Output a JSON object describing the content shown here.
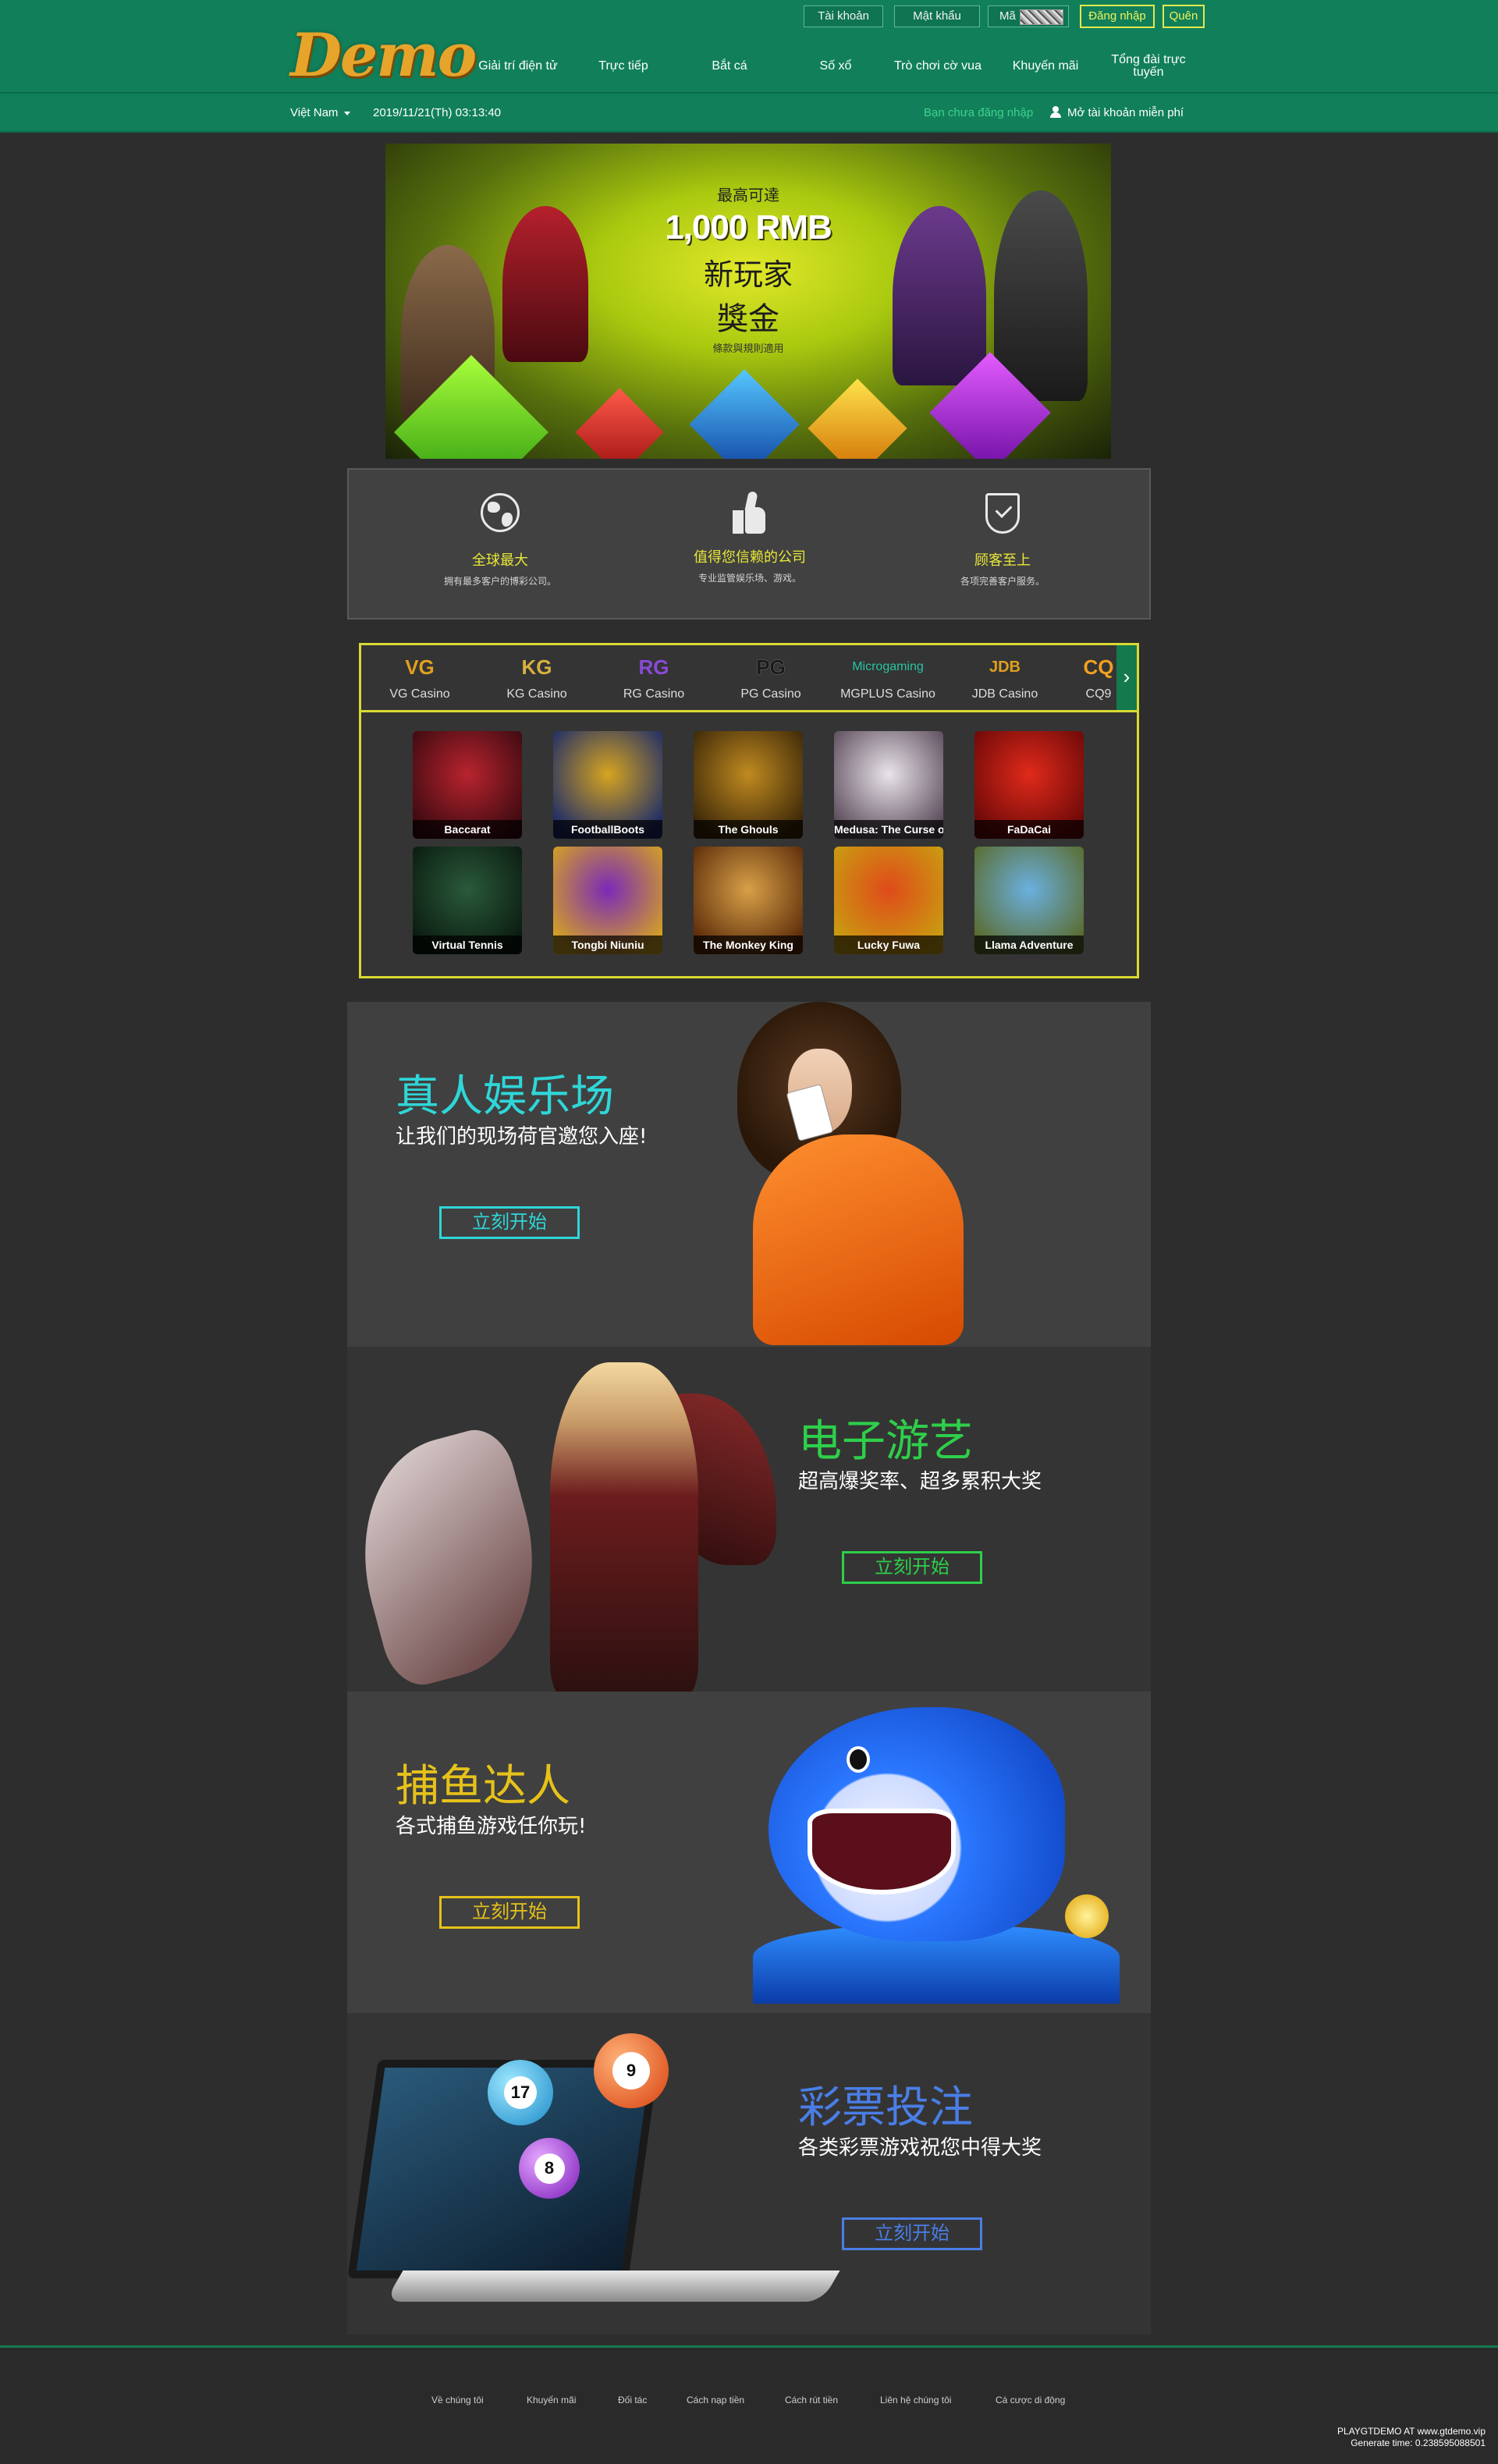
{
  "header": {
    "logo_text": "Demo",
    "auth": {
      "account_placeholder": "Tài khoản",
      "password_placeholder": "Mật khẩu",
      "captcha_label": "Mã",
      "login_label": "Đăng nhập",
      "forgot_label": "Quên"
    },
    "nav": [
      {
        "label": "Giải trí điện tử"
      },
      {
        "label": "Trực tiếp"
      },
      {
        "label": "Bắt cá"
      },
      {
        "label": "Số xổ"
      },
      {
        "label": "Trò chơi cờ vua"
      },
      {
        "label": "Khuyến mãi"
      },
      {
        "label": "Tổng đài trực tuyến"
      }
    ]
  },
  "subbar": {
    "language": "Việt Nam",
    "datetime": "2019/11/21(Th) 03:13:40",
    "not_logged_in": "Bạn chưa đăng nhập",
    "open_account": "Mở tài khoản miễn phí"
  },
  "banner": {
    "top": "最高可達",
    "amount": "1,000 RMB",
    "line1": "新玩家",
    "line2": "獎金",
    "small": "條款與規則適用"
  },
  "features": [
    {
      "icon": "globe-icon",
      "title": "全球最大",
      "desc": "拥有最多客户的博彩公司。"
    },
    {
      "icon": "thumbs-up-icon",
      "title": "值得您信赖的公司",
      "desc": "专业监管娱乐场、游戏。"
    },
    {
      "icon": "shield-check-icon",
      "title": "顾客至上",
      "desc": "各项完善客户服务。"
    }
  ],
  "providers": [
    {
      "logo": "VG",
      "name": "VG Casino",
      "color": "#e0a020"
    },
    {
      "logo": "KG",
      "name": "KG Casino",
      "color": "#d8b040"
    },
    {
      "logo": "RG",
      "name": "RG Casino",
      "color": "#8a4ad8"
    },
    {
      "logo": "PG",
      "name": "PG Casino",
      "color": "#222222"
    },
    {
      "logo": "Microgaming",
      "name": "MGPLUS Casino",
      "color": "#29c4a0"
    },
    {
      "logo": "JDB",
      "name": "JDB Casino",
      "color": "#e0a020"
    },
    {
      "logo": "CQ",
      "name": "CQ9",
      "color": "#f0a020"
    }
  ],
  "games": [
    {
      "name": "Baccarat",
      "c1": "#b8232e",
      "c2": "#3a0a10"
    },
    {
      "name": "FootballBoots",
      "c1": "#d6a420",
      "c2": "#1a2a6a"
    },
    {
      "name": "The Ghouls",
      "c1": "#c08a20",
      "c2": "#3a2608"
    },
    {
      "name": "Medusa: The Curse of Athena",
      "c1": "#e9e4ea",
      "c2": "#5a4a5a"
    },
    {
      "name": "FaDaCai",
      "c1": "#e02a1a",
      "c2": "#6a0808"
    },
    {
      "name": "Virtual Tennis",
      "c1": "#2a5a3a",
      "c2": "#0a1a10"
    },
    {
      "name": "Tongbi Niuniu",
      "c1": "#7a2ab8",
      "c2": "#d6a420"
    },
    {
      "name": "The Monkey King",
      "c1": "#d8a048",
      "c2": "#5a2a08"
    },
    {
      "name": "Lucky Fuwa",
      "c1": "#e04a1a",
      "c2": "#c8a010"
    },
    {
      "name": "Llama Adventure",
      "c1": "#6ab0e0",
      "c2": "#5a6a2a"
    }
  ],
  "promos": [
    {
      "title": "真人娱乐场",
      "sub": "让我们的现场荷官邀您入座!",
      "button": "立刻开始",
      "color": "#2fd6d8"
    },
    {
      "title": "电子游艺",
      "sub": "超高爆奖率、超多累积大奖",
      "button": "立刻开始",
      "color": "#2ecf4a"
    },
    {
      "title": "捕鱼达人",
      "sub": "各式捕鱼游戏任你玩!",
      "button": "立刻开始",
      "color": "#e6c21a"
    },
    {
      "title": "彩票投注",
      "sub": "各类彩票游戏祝您中得大奖",
      "button": "立刻开始",
      "color": "#4a7ee6"
    }
  ],
  "lottery_balls": [
    "17",
    "9",
    "8"
  ],
  "footer": {
    "links": [
      "Về chúng tôi",
      "Khuyến mãi",
      "Đối tác",
      "Cách nạp tiền",
      "Cách rút tiền",
      "Liên hệ chúng tôi",
      "Cá cược di động"
    ],
    "credit_line1": "PLAYGTDEMO AT www.gtdemo.vip",
    "credit_line2": "Generate time: 0.238595088501"
  }
}
